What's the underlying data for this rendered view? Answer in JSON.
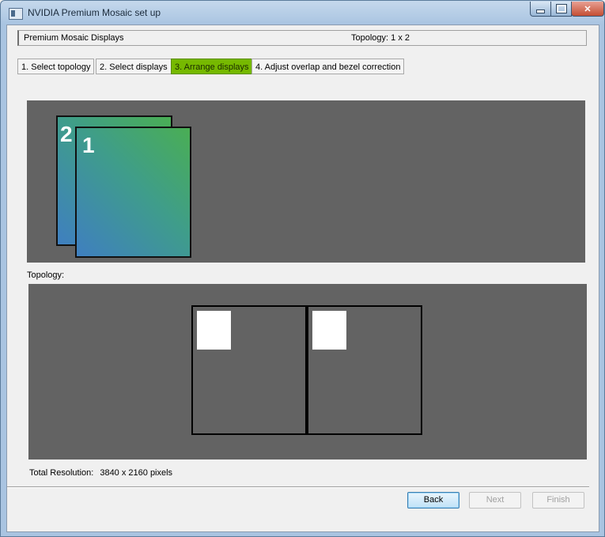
{
  "window": {
    "title": "NVIDIA Premium Mosaic set up",
    "icon": "app-window-icon"
  },
  "titlebar_buttons": {
    "minimize": "minimize-icon",
    "maximize": "maximize-icon",
    "close": "✕"
  },
  "header": {
    "left": "Premium Mosaic Displays",
    "right": "Topology: 1 x 2"
  },
  "steps": [
    {
      "label": "1. Select topology",
      "active": false
    },
    {
      "label": "2. Select displays",
      "active": false
    },
    {
      "label": "3. Arrange displays",
      "active": true
    },
    {
      "label": "4. Adjust overlap and bezel correction",
      "active": false
    }
  ],
  "arrange": {
    "displays": [
      {
        "number": "2"
      },
      {
        "number": "1"
      }
    ]
  },
  "topology": {
    "label": "Topology:",
    "rows": 1,
    "columns": 2
  },
  "total_resolution": {
    "label": "Total Resolution:",
    "value": "3840 x 2160 pixels"
  },
  "buttons": {
    "back": "Back",
    "next": "Next",
    "finish": "Finish"
  },
  "colors": {
    "active_step": "#76b900",
    "panel": "#636363"
  }
}
